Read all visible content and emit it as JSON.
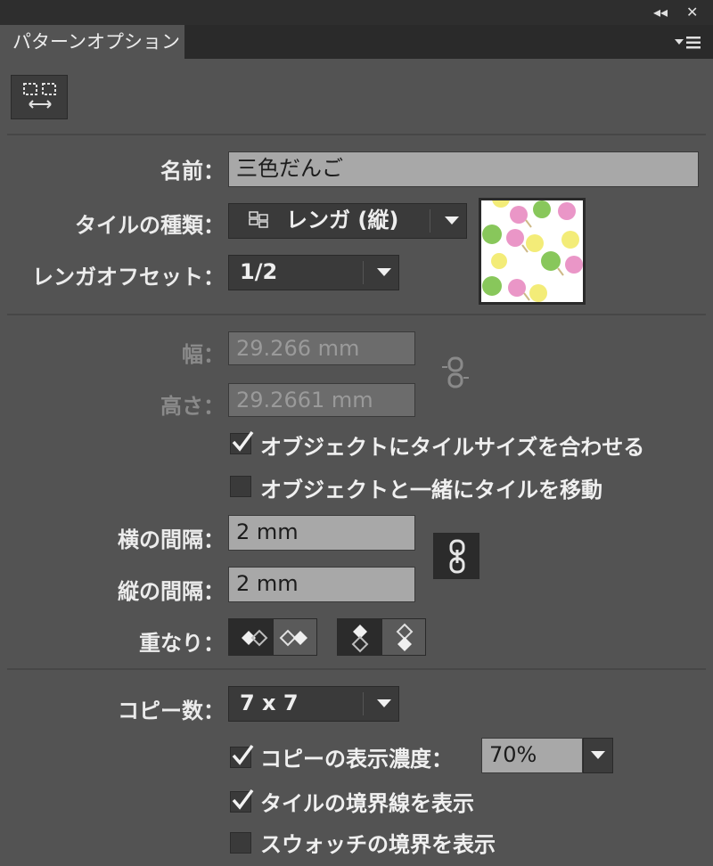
{
  "window": {
    "tab_title": "パターンオプション",
    "collapse_glyph": "◂◂",
    "close_glyph": "✕"
  },
  "fields": {
    "name_label": "名前：",
    "name_value": "三色だんご",
    "tile_type_label": "タイルの種類：",
    "tile_type_value": "レンガ (縦)",
    "brick_offset_label": "レンガオフセット：",
    "brick_offset_value": "1/2",
    "width_label": "幅：",
    "width_value": "29.266 mm",
    "height_label": "高さ：",
    "height_value": "29.2661 mm",
    "h_spacing_label": "横の間隔：",
    "h_spacing_value": "2 mm",
    "v_spacing_label": "縦の間隔：",
    "v_spacing_value": "2 mm",
    "overlap_label": "重なり：",
    "copies_label": "コピー数：",
    "copies_value": "7 x 7",
    "dim_copies_label": "コピーの表示濃度：",
    "dim_copies_value": "70%"
  },
  "checkboxes": {
    "size_tile_to_art": {
      "label": "オブジェクトにタイルサイズを合わせる",
      "checked": true
    },
    "move_tile_with_art": {
      "label": "オブジェクトと一緒にタイルを移動",
      "checked": false
    },
    "dim_copies": {
      "checked": true
    },
    "show_tile_edge": {
      "label": "タイルの境界線を表示",
      "checked": true
    },
    "show_swatch_bounds": {
      "label": "スウォッチの境界を表示",
      "checked": false
    }
  },
  "colors": {
    "panel_bg": "#535353",
    "dango_pink": "#e88bc2",
    "dango_green": "#7cc24a",
    "dango_yellow": "#f2ea6a"
  }
}
